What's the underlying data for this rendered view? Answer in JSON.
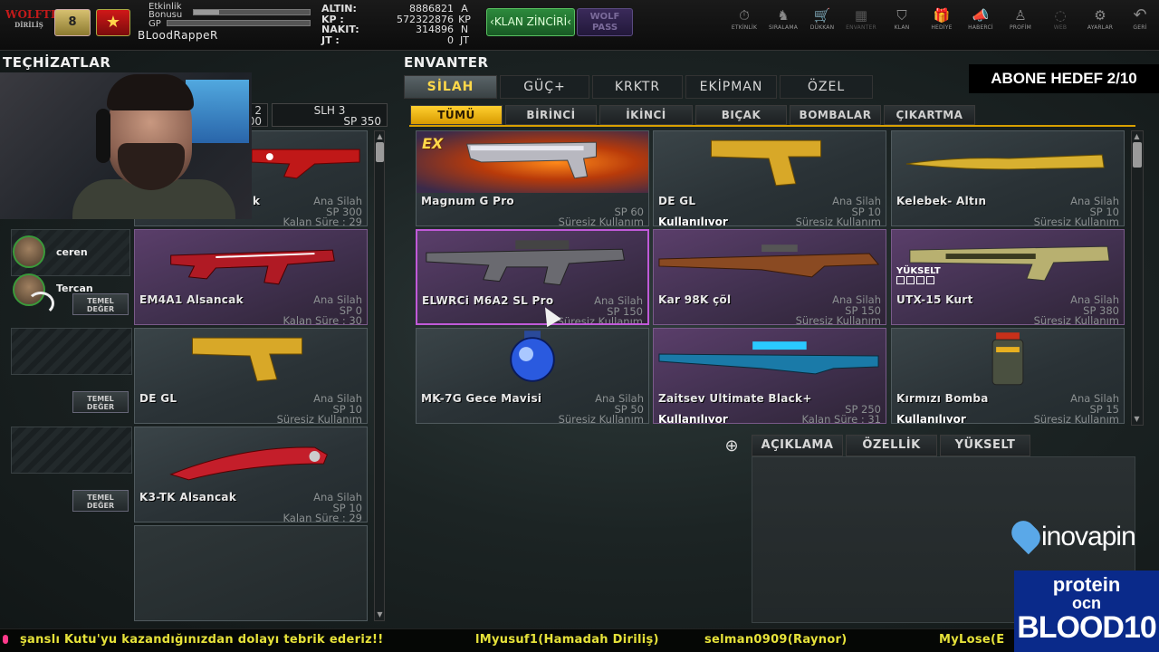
{
  "header": {
    "logo_main": "WOLFTEAM",
    "logo_sub": "DİRİLİŞ",
    "rank_badge": "8",
    "event_label_1": "Etkinlik",
    "event_label_2": "Bonusu",
    "gp_label": "GP",
    "event_bonus_fill": 0.22,
    "gp_fill": 0.0,
    "username": "BLoodRappeR",
    "currency": [
      {
        "key": "ALTIN:",
        "value": "8886821",
        "unit": "A"
      },
      {
        "key": "KP   :",
        "value": "572322876",
        "unit": "KP"
      },
      {
        "key": "NAKIT:",
        "value": "314896",
        "unit": "N"
      },
      {
        "key": "JT   :",
        "value": "0",
        "unit": "JT"
      }
    ],
    "klan_button": "‹KLAN ZİNCİRİ‹",
    "wolf_pass_line1": "WOLF",
    "wolf_pass_line2": "PASS",
    "nav": [
      {
        "label": "ETKİNLİK",
        "icon": "⏱"
      },
      {
        "label": "SIRALAMA",
        "icon": "♞"
      },
      {
        "label": "DÜKKAN",
        "icon": "🛒"
      },
      {
        "label": "ENVANTER",
        "icon": "▦"
      },
      {
        "label": "KLAN",
        "icon": "⛉"
      },
      {
        "label": "HEDİYE",
        "icon": "🎁"
      },
      {
        "label": "HABERCİ",
        "icon": "📣"
      },
      {
        "label": "PROFİM",
        "icon": "♙"
      },
      {
        "label": "WEB",
        "icon": "◌"
      },
      {
        "label": "AYARLAR",
        "icon": "⚙"
      },
      {
        "label": "GERİ",
        "icon": "↶"
      }
    ]
  },
  "sections": {
    "equipment_title": "TEÇHİZATLAR",
    "inventory_title": "ENVANTER",
    "abone_hedef": "ABONE HEDEF 2/10"
  },
  "left": {
    "slot_tabs": [
      {
        "line1": "2",
        "line2": "SP 400"
      },
      {
        "line1": "SLH 3",
        "line2": "SP 350"
      }
    ],
    "friends": [
      {
        "name": "ceren"
      },
      {
        "name": "Tercan"
      }
    ],
    "temel_line1": "TEMEL",
    "temel_line2": "DEĞER",
    "cards": [
      {
        "name": "",
        "partial_name": "k",
        "type": "Ana Silah",
        "sp": "SP 300",
        "time": "Kalan Süre : 29"
      },
      {
        "name": "EM4A1 Alsancak",
        "type": "Ana Silah",
        "sp": "SP 0",
        "time": "Kalan Süre : 30"
      },
      {
        "name": "DE GL",
        "type": "Ana Silah",
        "sp": "SP 10",
        "time": "Süresiz Kullanım"
      },
      {
        "name": "K3-TK Alsancak",
        "type": "Ana Silah",
        "sp": "SP 10",
        "time": "Kalan Süre : 29"
      }
    ]
  },
  "inventory": {
    "tabs": [
      "SİLAH",
      "GÜÇ+",
      "KRKTR",
      "EKİPMAN",
      "ÖZEL"
    ],
    "subtabs": [
      "TÜMÜ",
      "BİRİNCİ",
      "İKİNCİ",
      "BIÇAK",
      "BOMBALAR",
      "ÇIKARTMA"
    ],
    "items": [
      {
        "name": "Magnum G Pro",
        "type": "",
        "sp": "SP 60",
        "time": "Süresiz Kullanım",
        "badge": "EX",
        "in_use": ""
      },
      {
        "name": "DE GL",
        "type": "Ana Silah",
        "sp": "SP 10",
        "time": "Süresiz Kullanım",
        "badge": "",
        "in_use": "Kullanılıyor"
      },
      {
        "name": "Kelebek- Altın",
        "type": "Ana Silah",
        "sp": "SP 10",
        "time": "Süresiz Kullanım",
        "badge": "",
        "in_use": ""
      },
      {
        "name": "ELWRCi M6A2 SL Pro",
        "type": "Ana Silah",
        "sp": "SP 150",
        "time": "Süresiz Kullanım",
        "badge": "",
        "in_use": ""
      },
      {
        "name": "Kar 98K çöl",
        "type": "Ana Silah",
        "sp": "SP 150",
        "time": "Süresiz Kullanım",
        "badge": "",
        "in_use": ""
      },
      {
        "name": "UTX-15 Kurt",
        "type": "Ana Silah",
        "sp": "SP 380",
        "time": "Süresiz Kullanım",
        "badge": "YÜKSELT",
        "in_use": ""
      },
      {
        "name": "MK-7G Gece Mavisi",
        "type": "Ana Silah",
        "sp": "SP 50",
        "time": "Süresiz Kullanım",
        "badge": "",
        "in_use": ""
      },
      {
        "name": "Zaitsev Ultimate Black+",
        "type": "",
        "sp": "SP 250",
        "time": "Kalan Süre : 31",
        "badge": "",
        "in_use": "Kullanılıyor"
      },
      {
        "name": "Kırmızı Bomba",
        "type": "Ana Silah",
        "sp": "SP 15",
        "time": "Süresiz Kullanım",
        "badge": "",
        "in_use": "Kullanılıyor"
      }
    ],
    "detail_tabs": [
      "AÇIKLAMA",
      "ÖZELLİK",
      "YÜKSELT"
    ]
  },
  "sponsors": {
    "inova": "inovapin",
    "protein_1": "protein",
    "protein_2": "ocn",
    "protein_3": "BLOOD10"
  },
  "ticker": [
    "şanslı Kutu'yu kazandığınızdan dolayı tebrik ederiz!!",
    "lMyusuf1(Hamadah Diriliş)",
    "selman0909(Raynor)",
    "MyLose(E"
  ]
}
